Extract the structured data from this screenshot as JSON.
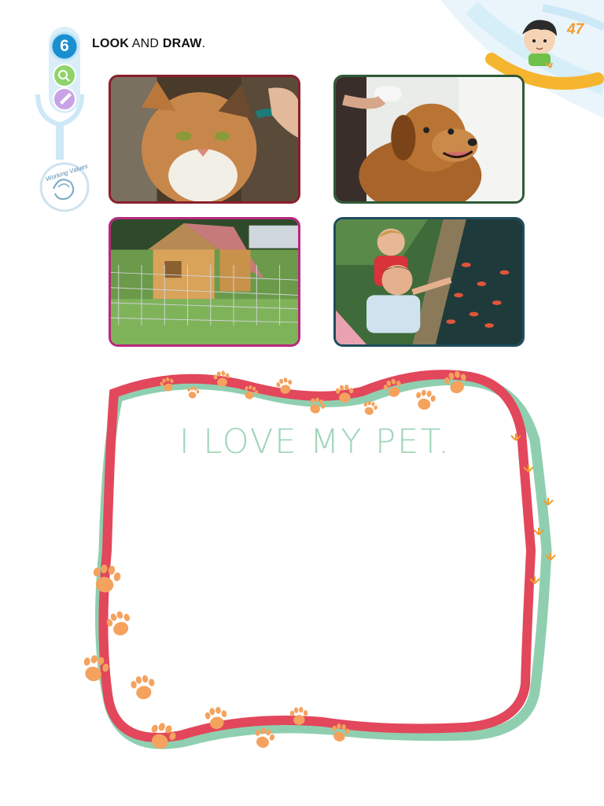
{
  "header": {
    "exercise_number": "6",
    "instruction_bold_1": "LOOK",
    "instruction_mid": " AND ",
    "instruction_bold_2": "DRAW",
    "instruction_end": ".",
    "page_number": "47"
  },
  "sidebar": {
    "icons": [
      "look-icon",
      "draw-icon"
    ],
    "badge_text": "Working Values"
  },
  "photos": [
    {
      "subject": "cat-photo",
      "border_color": "#8b1f2b"
    },
    {
      "subject": "dog-bath-photo",
      "border_color": "#2f5a36"
    },
    {
      "subject": "rabbit-hutch-photo",
      "border_color": "#b8287e"
    },
    {
      "subject": "fish-pond-photo",
      "border_color": "#1e4d5e"
    }
  ],
  "drawing_frame": {
    "title": "I LOVE MY PET.",
    "frame_color": "#e2475b",
    "shadow_color": "#8fcfb0",
    "paw_color": "#f4a25e"
  }
}
